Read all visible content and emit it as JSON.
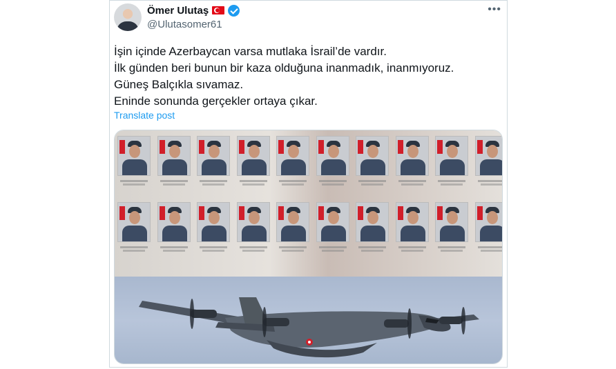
{
  "post": {
    "author_name": "Ömer Ulutaş",
    "handle": "@Ulutasomer61",
    "more_label": "•••",
    "lines": [
      "İşin içinde Azerbaycan varsa mutlaka İsrail’de vardır.",
      "İlk günden beri bunun bir kaza olduğuna inanmadık, inanmıyoruz.",
      "Güneş Balçıkla sıvamaz.",
      "Eninde sonunda gerçekler ortaya çıkar."
    ],
    "translate_label": "Translate post"
  },
  "icons": {
    "flag": "turkey-flag-icon",
    "verified": "verified-badge-icon",
    "more": "more-options-icon"
  },
  "colors": {
    "link": "#1d9bf0",
    "verified": "#1d9bf0",
    "secondary_text": "#536471",
    "flag_red": "#e30a17"
  },
  "media": {
    "type": "image",
    "description_elements": [
      "memorial-portrait-grid",
      "c130-aircraft-photo"
    ],
    "portrait_count": 20
  }
}
